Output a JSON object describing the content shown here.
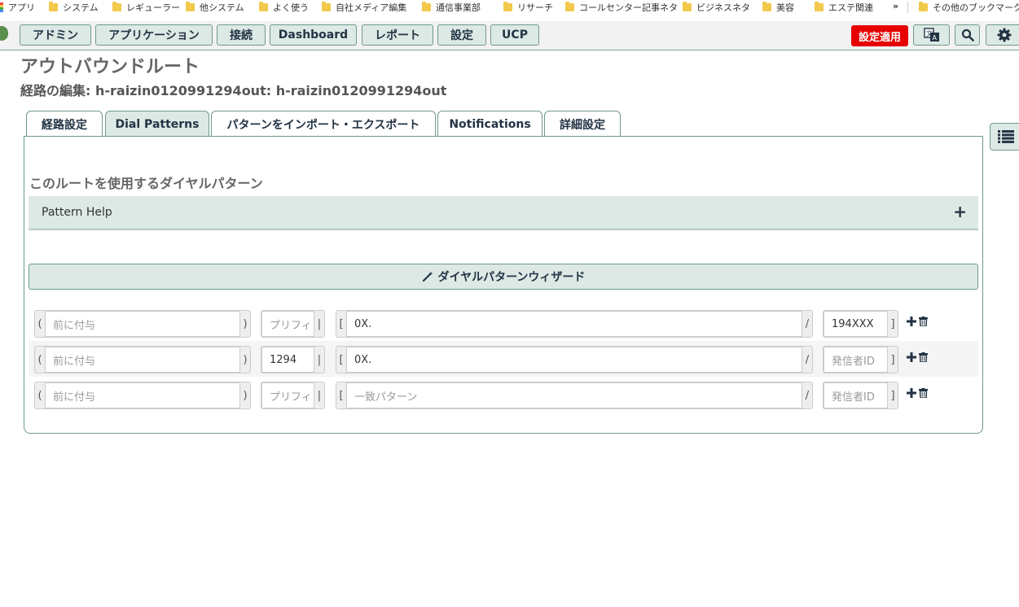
{
  "bookmarks": {
    "items": [
      "アプリ",
      "システム",
      "レギューラー",
      "他システム",
      "よく使う",
      "自社メディア編集",
      "通信事業部",
      "リサーチ",
      "コールセンター記事ネタ",
      "ビジネスネタ",
      "美容",
      "エステ関連"
    ],
    "more": "»",
    "other": "その他のブックマーク"
  },
  "nav": {
    "items": [
      "アドミン",
      "アプリケーション",
      "接続",
      "Dashboard",
      "レポート",
      "設定",
      "UCP"
    ],
    "apply": "設定適用"
  },
  "page": {
    "title": "アウトバウンドルート",
    "subtitle": "経路の編集: h-raizin0120991294out: h-raizin0120991294out"
  },
  "tabs": [
    "経路設定",
    "Dial Patterns",
    "パターンをインポート・エクスポート",
    "Notifications",
    "詳細設定"
  ],
  "section": {
    "title": "このルートを使用するダイヤルパターン",
    "help": "Pattern Help",
    "help_toggle": "+",
    "wizard": "ダイヤルパターンウィザード"
  },
  "rows": [
    {
      "prepend": "",
      "prepend_ph": "前に付与",
      "prefix": "",
      "prefix_ph": "プリフィックス",
      "match": "0X.",
      "match_ph": "一致パターン",
      "cid": "194XXX",
      "cid_ph": "発信者ID"
    },
    {
      "prepend": "",
      "prepend_ph": "前に付与",
      "prefix": "1294",
      "prefix_ph": "プリフィックス",
      "match": "0X.",
      "match_ph": "一致パターン",
      "cid": "",
      "cid_ph": "発信者ID"
    },
    {
      "prepend": "",
      "prepend_ph": "前に付与",
      "prefix": "",
      "prefix_ph": "プリフィックス",
      "match": "",
      "match_ph": "一致パターン",
      "cid": "",
      "cid_ph": "発信者ID"
    }
  ],
  "brackets": {
    "open": "(",
    "close": ")",
    "pipe": "|",
    "sq_open": "[",
    "slash": "/",
    "sq_close": "]"
  },
  "icons": {
    "add": "plus-icon",
    "delete": "trash-icon",
    "settings": "gear-icon",
    "search": "search-icon",
    "language": "language-icon",
    "list": "list-icon",
    "wand": "magic-wand-icon"
  },
  "colors": {
    "accent": "#dde9e5",
    "border": "#6f9a8c",
    "apply": "#e60000",
    "text": "#234"
  }
}
